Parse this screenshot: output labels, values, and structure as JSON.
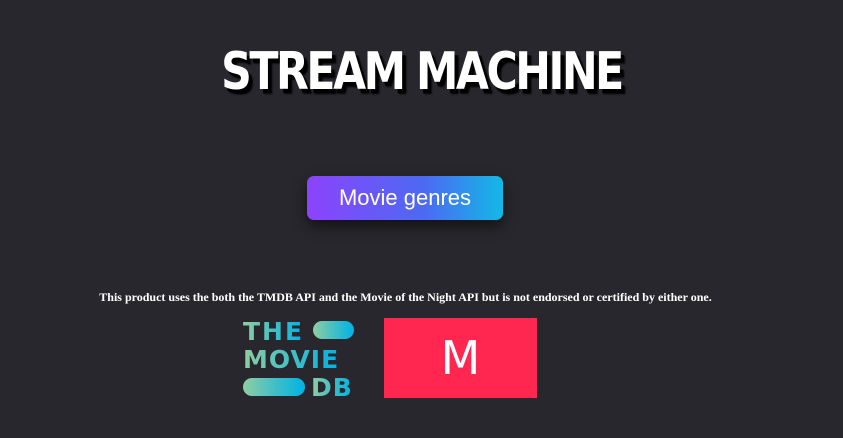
{
  "app": {
    "title": "STREAM MACHINE"
  },
  "actions": {
    "genres_button_label": "Movie genres"
  },
  "footer": {
    "disclaimer": "This product uses the both the TMDB API and the Movie of the Night API but is not endorsed or certified by either one.",
    "tmdb_logo": {
      "line1": "THE",
      "line2": "MOVIE",
      "line3": "DB",
      "colors": [
        "#90cea1",
        "#3cbec9",
        "#00b3e5"
      ]
    },
    "motn_logo": {
      "letter": "M",
      "color": "#ff2750"
    }
  },
  "colors": {
    "background": "#28272d",
    "button_gradient": [
      "#8c43fb",
      "#12b9e6"
    ]
  }
}
